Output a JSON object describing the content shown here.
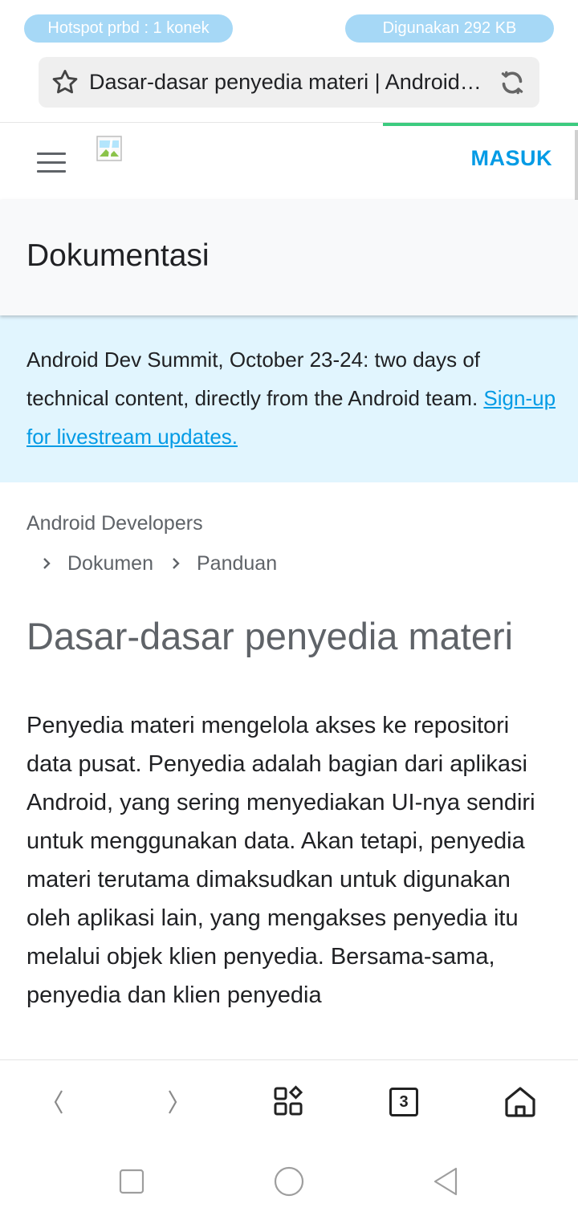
{
  "status": {
    "hotspot": "Hotspot prbd : 1 konek",
    "data_used": "Digunakan 292 KB"
  },
  "browser": {
    "url_title": "Dasar-dasar penyedia materi  |  Android Developers",
    "tab_count": "3"
  },
  "site": {
    "signin_label": "MASUK",
    "section_title": "Dokumentasi"
  },
  "announcement": {
    "text": "Android Dev Summit, October 23-24: two days of technical content, directly from the Android team. ",
    "link": "Sign-up for livestream updates."
  },
  "breadcrumb": {
    "root": "Android Developers",
    "items": [
      "Dokumen",
      "Panduan"
    ]
  },
  "article": {
    "title": "Dasar-dasar penyedia materi",
    "body": "Penyedia materi mengelola akses ke repositori data pusat. Penyedia adalah bagian dari aplikasi Android, yang sering menyediakan UI-nya sendiri untuk menggunakan data. Akan tetapi, penyedia materi terutama dimaksudkan untuk digunakan oleh aplikasi lain, yang mengakses penyedia itu melalui objek klien penyedia. Bersama-sama, penyedia dan klien penyedia"
  },
  "icons": {
    "bookmark": "star-icon",
    "reload": "reload-icon",
    "menu": "hamburger-menu-icon",
    "back": "chevron-left-icon",
    "forward": "chevron-right-icon",
    "apps": "apps-grid-icon",
    "tabs": "tab-switcher-icon",
    "home": "home-icon"
  },
  "colors": {
    "accent": "#039be5",
    "progress": "#3ccb7f",
    "banner_bg": "#e1f5fe",
    "pill_bg": "#a6d8f6"
  }
}
